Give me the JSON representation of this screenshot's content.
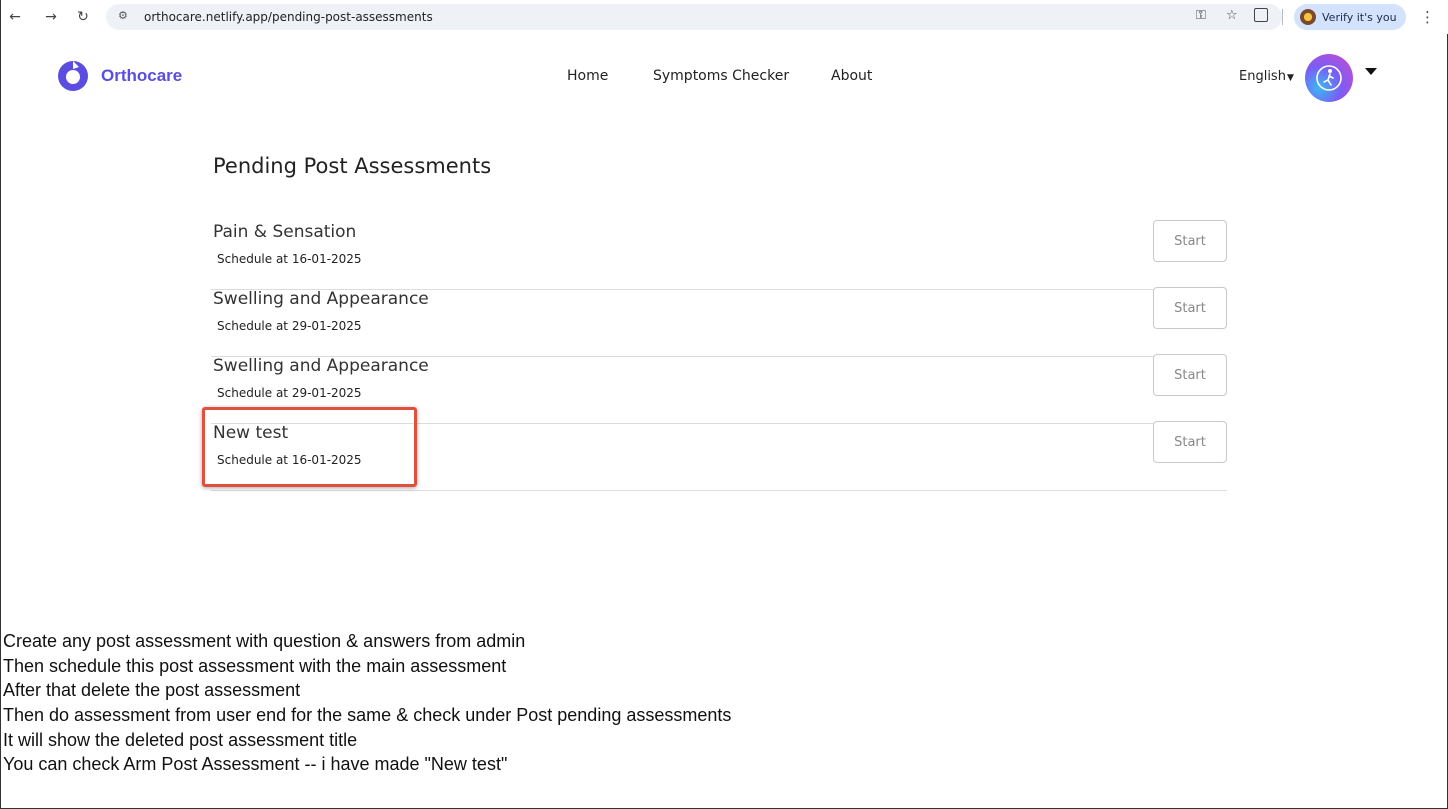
{
  "browser": {
    "url": "orthocare.netlify.app/pending-post-assessments",
    "profile_label": "Verify it's you",
    "icons": {
      "back": "arrow-left-icon",
      "forward": "arrow-right-icon",
      "reload": "reload-icon",
      "site_info": "tune-icon",
      "password": "key-icon",
      "bookmark": "star-icon",
      "extensions": "puzzle-icon",
      "menu": "kebab-menu-icon"
    }
  },
  "header": {
    "brand": "Orthocare",
    "brand_color": "#5b4de0",
    "nav": [
      {
        "label": "Home"
      },
      {
        "label": "Symptoms Checker"
      },
      {
        "label": "About"
      }
    ],
    "language": "English"
  },
  "main": {
    "title": "Pending Post Assessments",
    "assessments": [
      {
        "title": "Pain & Sensation",
        "schedule": "Schedule at 16-01-2025",
        "action": "Start"
      },
      {
        "title": "Swelling and Appearance",
        "schedule": "Schedule at 29-01-2025",
        "action": "Start"
      },
      {
        "title": "Swelling and Appearance",
        "schedule": "Schedule at 29-01-2025",
        "action": "Start"
      },
      {
        "title": "New test",
        "schedule": "Schedule at 16-01-2025",
        "action": "Start"
      }
    ],
    "highlight_color": "#e0503e"
  },
  "notes": [
    "Create any post assessment with question & answers from admin",
    "Then schedule this post assessment with the main assessment",
    "After that delete the post assessment",
    "Then do assessment from user end for the same & check under Post pending assessments",
    "It will show the deleted post assessment title",
    "You can check Arm Post Assessment -- i have made \"New test\""
  ]
}
